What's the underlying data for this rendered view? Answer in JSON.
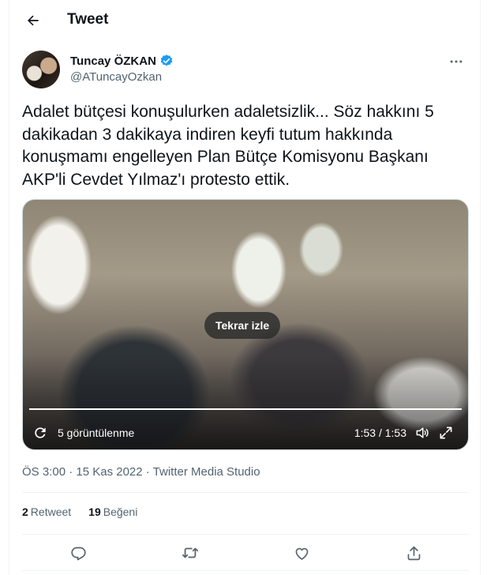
{
  "header": {
    "title": "Tweet",
    "back_icon": "arrow-left-icon"
  },
  "author": {
    "display_name": "Tuncay ÖZKAN",
    "handle": "@ATuncayOzkan",
    "verified": true,
    "verified_color": "#1d9bf0"
  },
  "tweet": {
    "text": "Adalet bütçesi konuşulurken adaletsizlik... Söz hakkını 5 dakikadan 3 dakikaya indiren keyfi tutum hakkında konuşmamı engelleyen Plan Bütçe Komisyonu Başkanı AKP'li Cevdet Yılmaz'ı protesto ettik."
  },
  "video": {
    "replay_label": "Tekrar izle",
    "views_label": "5 görüntülenme",
    "time_label": "1:53 / 1:53",
    "progress": 1.0
  },
  "meta": {
    "timestamp": "ÖS 3:00 · 15 Kas 2022 · ",
    "source": "Twitter Media Studio"
  },
  "stats": {
    "retweets_count": "2",
    "retweets_label": "Retweet",
    "likes_count": "19",
    "likes_label": "Beğeni"
  },
  "actions": [
    "reply-icon",
    "retweet-icon",
    "like-icon",
    "share-icon"
  ]
}
